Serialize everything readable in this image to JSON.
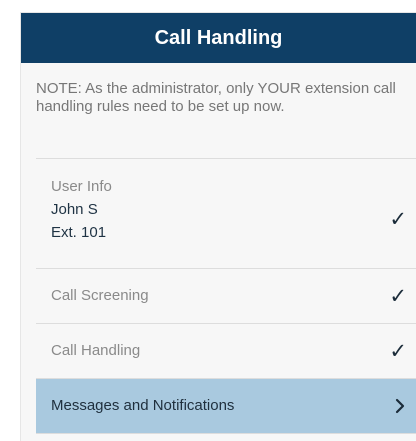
{
  "header": {
    "title": "Call Handling"
  },
  "note": {
    "text": "NOTE: As the administrator, only YOUR extension call handling rules need to be set up now."
  },
  "list": {
    "user_info": {
      "label": "User Info",
      "name": "John S",
      "extension": "Ext. 101",
      "status_icon": "check-icon"
    },
    "call_screening": {
      "label": "Call Screening",
      "status_icon": "check-icon"
    },
    "call_handling": {
      "label": "Call Handling",
      "status_icon": "check-icon"
    },
    "messages_notifications": {
      "label": "Messages and Notifications",
      "status_icon": "chevron-right-icon",
      "highlight_color": "#a9c9df"
    }
  },
  "colors": {
    "header_bg": "#0f3f66",
    "header_text": "#ffffff",
    "note_text": "#777777",
    "active_row": "#a9c9df"
  }
}
